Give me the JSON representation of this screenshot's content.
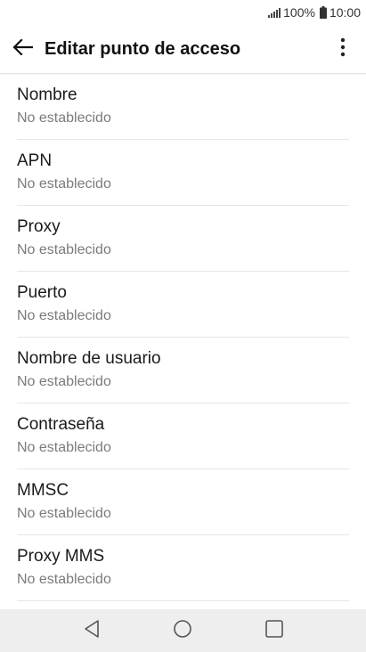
{
  "status_bar": {
    "battery_percent": "100%",
    "time": "10:00",
    "icons": [
      "signal-icon",
      "battery-icon"
    ]
  },
  "app_bar": {
    "title": "Editar punto de acceso",
    "back_icon": "arrow-left-icon",
    "menu_icon": "overflow-menu-icon"
  },
  "items": [
    {
      "title": "Nombre",
      "value": "No establecido"
    },
    {
      "title": "APN",
      "value": "No establecido"
    },
    {
      "title": "Proxy",
      "value": "No establecido"
    },
    {
      "title": "Puerto",
      "value": "No establecido"
    },
    {
      "title": "Nombre de usuario",
      "value": "No establecido"
    },
    {
      "title": "Contraseña",
      "value": "No establecido"
    },
    {
      "title": "MMSC",
      "value": "No establecido"
    },
    {
      "title": "Proxy MMS",
      "value": "No establecido"
    }
  ],
  "nav_bar": {
    "icons": [
      "back-triangle-icon",
      "home-circle-icon",
      "recents-square-icon"
    ]
  }
}
